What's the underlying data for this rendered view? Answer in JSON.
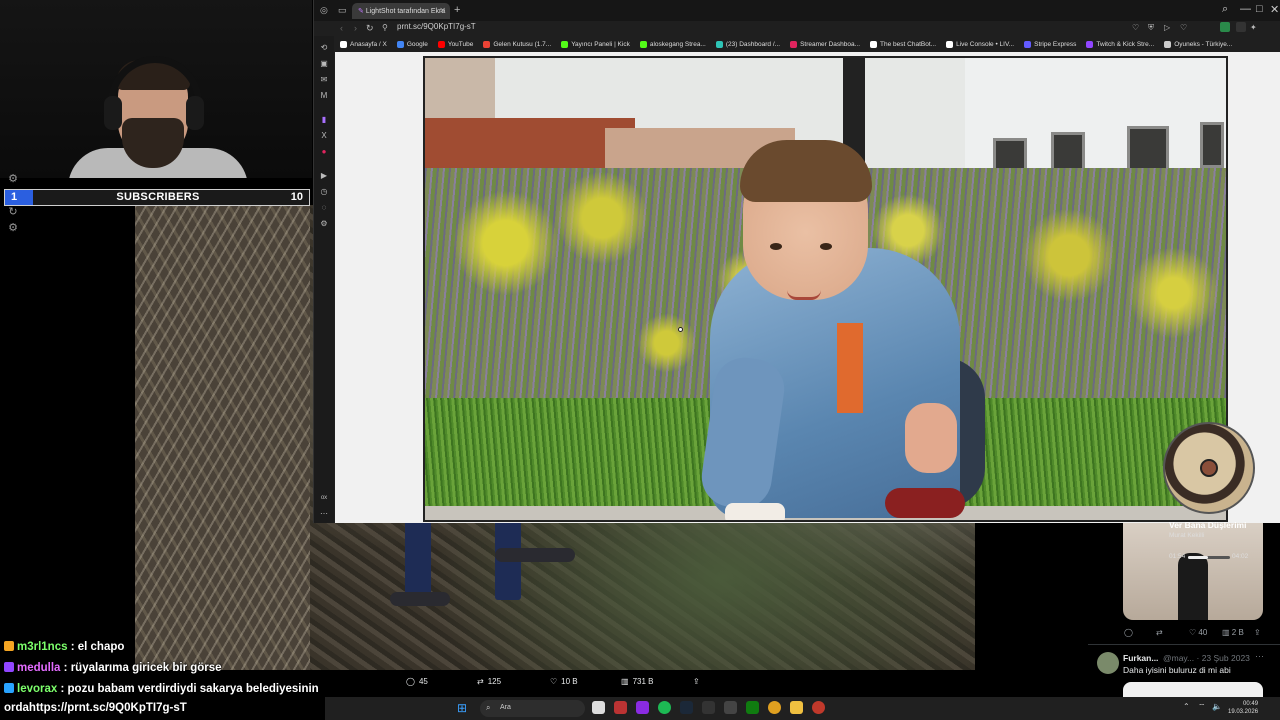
{
  "overlay": {
    "subscribers": {
      "label": "SUBSCRIBERS",
      "current": "1",
      "goal": "10",
      "fraction": 0.1
    }
  },
  "browser": {
    "tab_title": "LightShot tarafından Ekra",
    "url": "prnt.sc/9Q0KpTI7g-sT",
    "bookmarks": [
      {
        "label": "Anasayfa / X",
        "color": "#ffffff"
      },
      {
        "label": "Google",
        "color": "#4285f4"
      },
      {
        "label": "YouTube",
        "color": "#ff0000"
      },
      {
        "label": "Gelen Kutusu (1.7...",
        "color": "#ea4335"
      },
      {
        "label": "Yayıncı Paneli | Kick",
        "color": "#53fc18"
      },
      {
        "label": "aloskegang Strea...",
        "color": "#53fc18"
      },
      {
        "label": "(23) Dashboard /...",
        "color": "#2ec4b6"
      },
      {
        "label": "Streamer Dashboa...",
        "color": "#e0245e"
      },
      {
        "label": "The best ChatBot...",
        "color": "#ffffff"
      },
      {
        "label": "Live Console • LIV...",
        "color": "#ffffff"
      },
      {
        "label": "Stripe Express",
        "color": "#635bff"
      },
      {
        "label": "Twitch & Kick Stre...",
        "color": "#9146ff"
      },
      {
        "label": "Oyuneks - Türkiye...",
        "color": "#cccccc"
      }
    ]
  },
  "music": {
    "title": "Ver Bana Düşlerimi",
    "artist": "Murat Kekilli",
    "current_time": "01:54",
    "duration": "04:02",
    "progress": 0.47
  },
  "tweet": {
    "likes": "40",
    "views": "2 B",
    "reply": {
      "name": "Furkan...",
      "meta": "@may... · 23 Şub 2023",
      "text": "Daha iyisini buluruz di mi abi"
    }
  },
  "post_actions": {
    "replies": "45",
    "reposts": "125",
    "likes": "10 B",
    "views": "731 B"
  },
  "chat": [
    {
      "user": "m3rl1ncs",
      "message": "el chapo",
      "color": "#7cff6b",
      "badge": "#f5a623"
    },
    {
      "user": "medulla",
      "message": "rüyalarıma giricek bir görse",
      "color": "#e36cff",
      "badge": "#9146ff"
    },
    {
      "user": "levorax",
      "message": "pozu babam verdirdiydi sakarya belediyesinin",
      "color": "#7cff6b",
      "badge": "#29a3ff"
    },
    {
      "user": "",
      "message": "ordahttps://prnt.sc/9Q0KpTI7g-sT",
      "color": "#ffffff",
      "badge": ""
    }
  ],
  "taskbar": {
    "search_placeholder": "Ara",
    "time": "00:49",
    "date": "19.03.2026"
  },
  "accent": "#2b5fe0"
}
